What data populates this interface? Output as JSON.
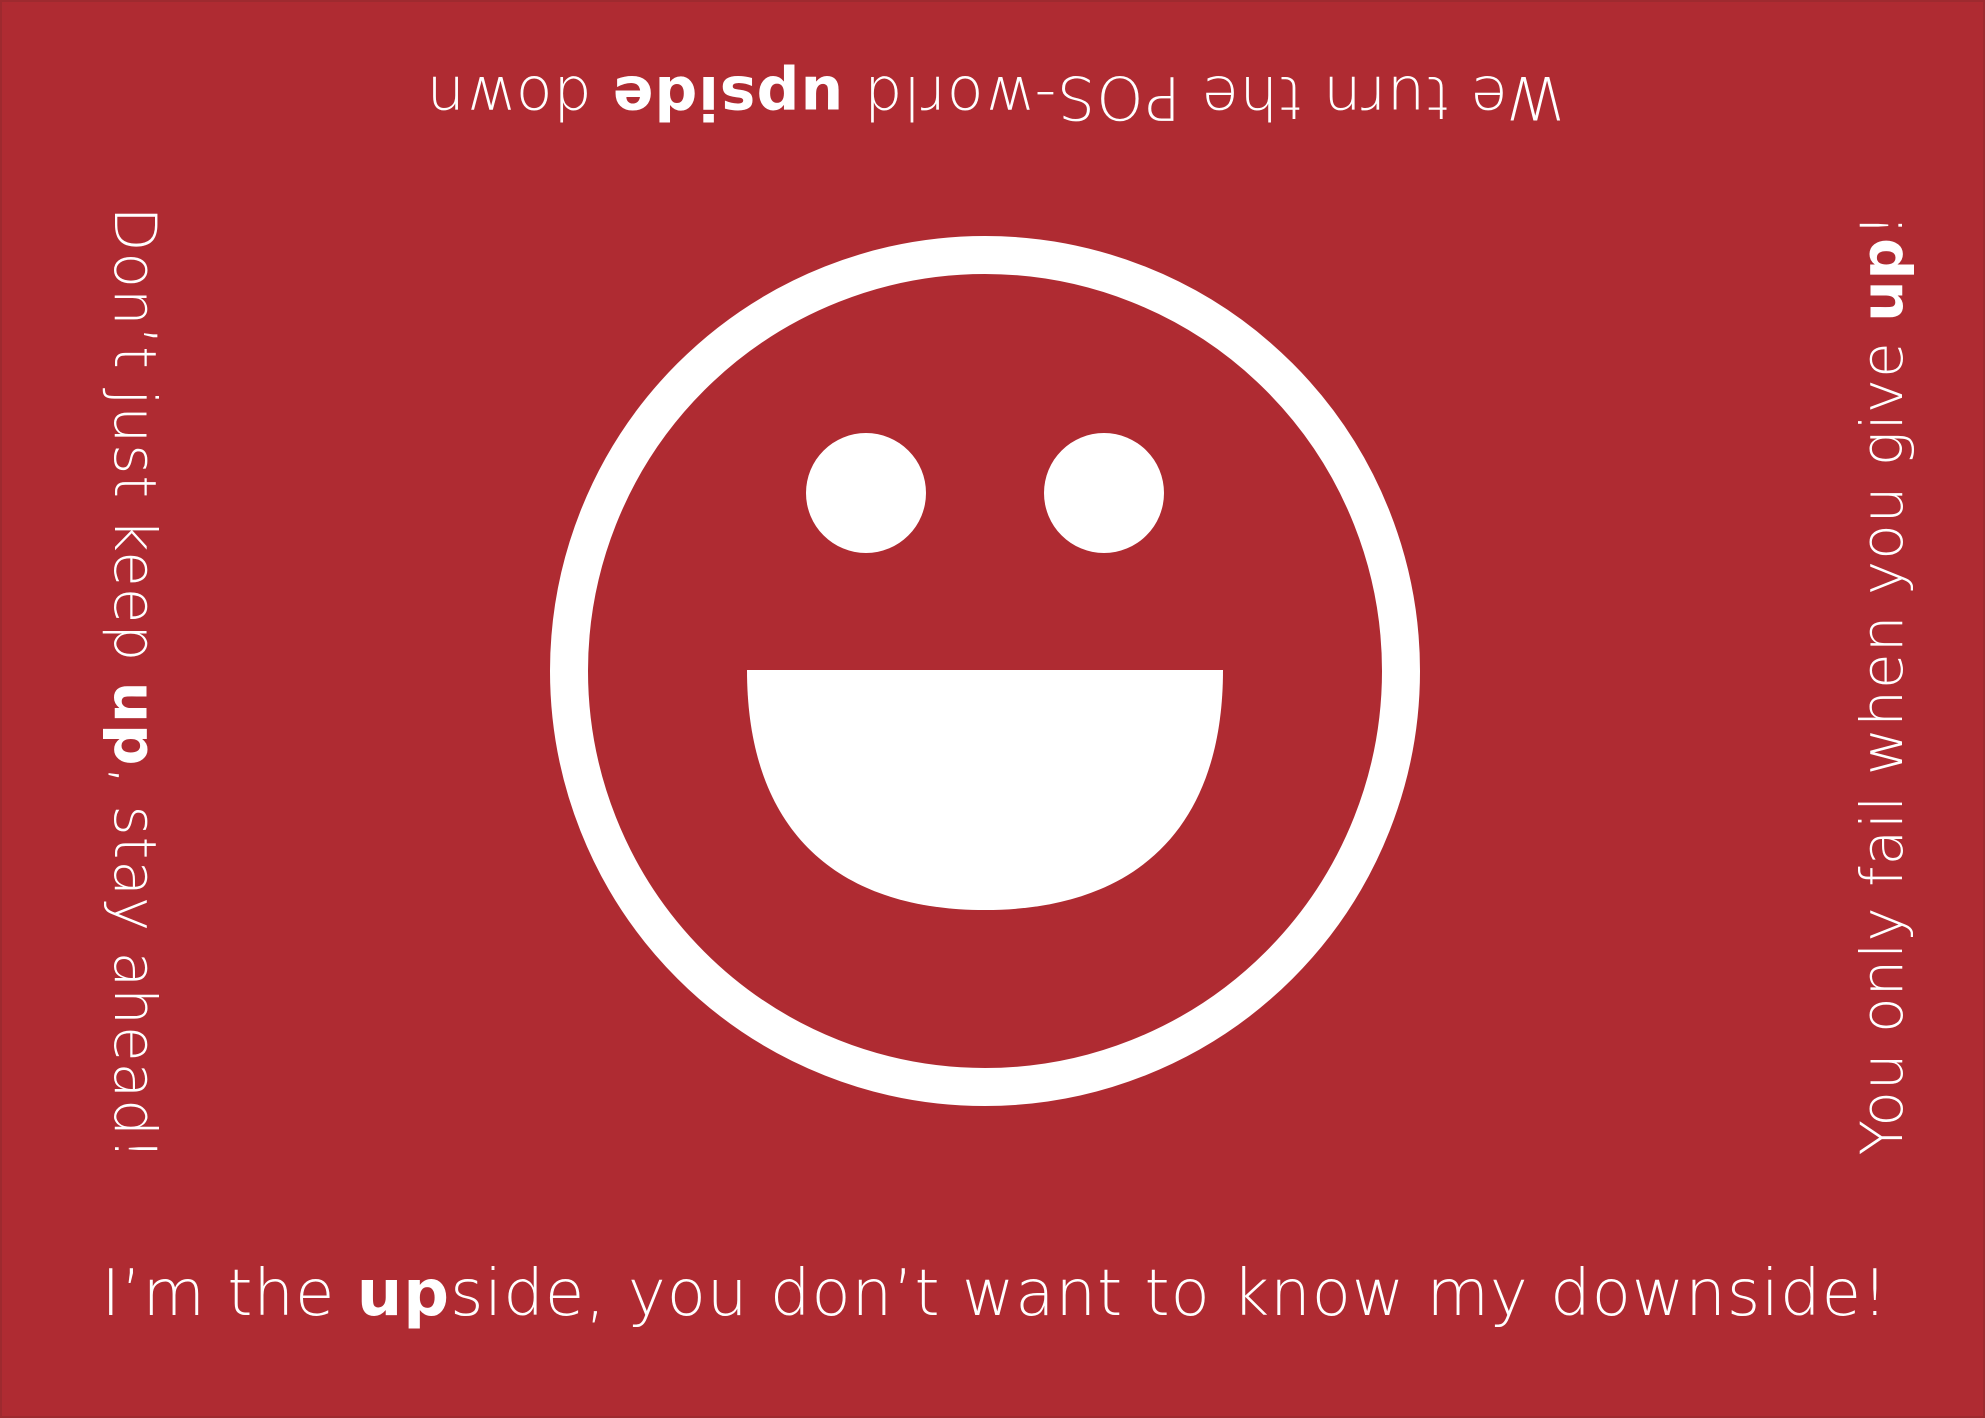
{
  "colors": {
    "background": "#af2b32",
    "foreground": "#ffffff"
  },
  "icon": "smiley-face-icon",
  "slogans": {
    "bottom": {
      "before": "I’m the ",
      "bold": "up",
      "after": "side, you don’t want to know my downside!"
    },
    "top": {
      "before": "We turn the POS-world ",
      "bold": "upside",
      "after": " down"
    },
    "left": {
      "before": "Don’t just keep ",
      "bold": "up",
      "after": ", stay ahead!"
    },
    "right": {
      "before": "You only fail when you give ",
      "bold": "up",
      "after": "!"
    }
  }
}
